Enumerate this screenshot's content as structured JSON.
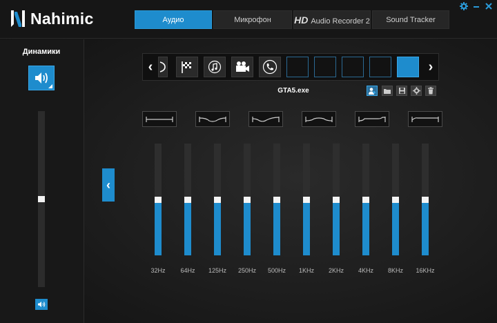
{
  "app": {
    "brand": "Nahimic",
    "accent": "#1e8ccd"
  },
  "tabs": [
    {
      "label": "Аудио",
      "active": true
    },
    {
      "label": "Микрофон",
      "active": false
    },
    {
      "label": "Audio Recorder 2",
      "prefix": "HD",
      "active": false
    },
    {
      "label": "Sound Tracker",
      "active": false
    }
  ],
  "window_controls": [
    "gear-icon",
    "minimize-icon",
    "close-icon"
  ],
  "left_panel": {
    "title": "Динамики",
    "device_icon": "speaker-icon",
    "volume_level": 0.5
  },
  "profiles": {
    "slots": [
      {
        "icon": "partial-icon",
        "state": "filled"
      },
      {
        "icon": "checkered-flag-icon",
        "state": "filled"
      },
      {
        "icon": "music-note-icon",
        "state": "filled"
      },
      {
        "icon": "video-camera-icon",
        "state": "filled"
      },
      {
        "icon": "phone-icon",
        "state": "filled"
      },
      {
        "icon": "",
        "state": "empty"
      },
      {
        "icon": "",
        "state": "empty"
      },
      {
        "icon": "",
        "state": "empty"
      },
      {
        "icon": "",
        "state": "empty"
      },
      {
        "icon": "",
        "state": "selected"
      }
    ],
    "current_name": "GTA5.exe",
    "tools": [
      "add-user-icon",
      "folder-icon",
      "save-icon",
      "gear-icon",
      "trash-icon"
    ]
  },
  "presets": [
    "flat-preset",
    "bass-boost-preset",
    "treble-boost-preset",
    "vocal-preset",
    "loudness-preset",
    "high-shelf-preset"
  ],
  "equalizer": {
    "bands": [
      {
        "label": "32Hz",
        "level": 0.5
      },
      {
        "label": "64Hz",
        "level": 0.5
      },
      {
        "label": "125Hz",
        "level": 0.5
      },
      {
        "label": "250Hz",
        "level": 0.5
      },
      {
        "label": "500Hz",
        "level": 0.5
      },
      {
        "label": "1KHz",
        "level": 0.5
      },
      {
        "label": "2KHz",
        "level": 0.5
      },
      {
        "label": "4KHz",
        "level": 0.5
      },
      {
        "label": "8KHz",
        "level": 0.5
      },
      {
        "label": "16KHz",
        "level": 0.5
      }
    ]
  }
}
